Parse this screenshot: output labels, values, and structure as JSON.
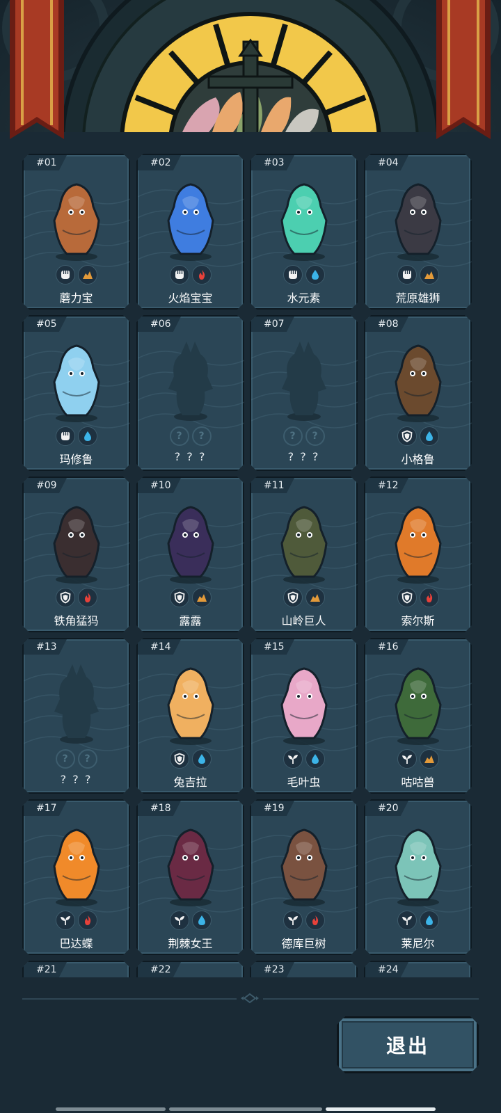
{
  "header": {
    "window_colors": [
      "#f2c84a",
      "#e9a86d",
      "#8aa36a",
      "#d9a4b0",
      "#c9c7c0"
    ],
    "banner_color": "#9b3320"
  },
  "cards": [
    {
      "number": "#01",
      "name": "蘑力宝",
      "types": [
        "fist-icon",
        "earth-icon"
      ],
      "locked": false,
      "color": "#b86a3a"
    },
    {
      "number": "#02",
      "name": "火焰宝宝",
      "types": [
        "fist-icon",
        "fire-icon"
      ],
      "locked": false,
      "color": "#3f7de0"
    },
    {
      "number": "#03",
      "name": "水元素",
      "types": [
        "fist-icon",
        "water-icon"
      ],
      "locked": false,
      "color": "#4ccfb0"
    },
    {
      "number": "#04",
      "name": "荒原雄狮",
      "types": [
        "fist-icon",
        "earth-icon"
      ],
      "locked": false,
      "color": "#3b3a44"
    },
    {
      "number": "#05",
      "name": "玛修鲁",
      "types": [
        "fist-icon",
        "water-icon"
      ],
      "locked": false,
      "color": "#8fd0ef"
    },
    {
      "number": "#06",
      "name": "? ? ?",
      "types": [
        "?",
        "?"
      ],
      "locked": true,
      "color": "#233b48"
    },
    {
      "number": "#07",
      "name": "? ? ?",
      "types": [
        "?",
        "?"
      ],
      "locked": true,
      "color": "#233b48"
    },
    {
      "number": "#08",
      "name": "小格鲁",
      "types": [
        "shield-icon",
        "water-icon"
      ],
      "locked": false,
      "color": "#6b4a2e"
    },
    {
      "number": "#09",
      "name": "铁角猛犸",
      "types": [
        "shield-icon",
        "fire-icon"
      ],
      "locked": false,
      "color": "#3a2e30"
    },
    {
      "number": "#10",
      "name": "露露",
      "types": [
        "shield-icon",
        "earth-icon"
      ],
      "locked": false,
      "color": "#3a2e5a"
    },
    {
      "number": "#11",
      "name": "山岭巨人",
      "types": [
        "shield-icon",
        "earth-icon"
      ],
      "locked": false,
      "color": "#4f5a3a"
    },
    {
      "number": "#12",
      "name": "索尔斯",
      "types": [
        "shield-icon",
        "fire-icon"
      ],
      "locked": false,
      "color": "#e07a2a"
    },
    {
      "number": "#13",
      "name": "? ? ?",
      "types": [
        "?",
        "?"
      ],
      "locked": true,
      "color": "#233b48"
    },
    {
      "number": "#14",
      "name": "兔吉拉",
      "types": [
        "shield-icon",
        "water-icon"
      ],
      "locked": false,
      "color": "#f0b060"
    },
    {
      "number": "#15",
      "name": "毛叶虫",
      "types": [
        "sprout-icon",
        "water-icon"
      ],
      "locked": false,
      "color": "#e8a8c8"
    },
    {
      "number": "#16",
      "name": "咕咕兽",
      "types": [
        "sprout-icon",
        "earth-icon"
      ],
      "locked": false,
      "color": "#3e6a3a"
    },
    {
      "number": "#17",
      "name": "巴达蝶",
      "types": [
        "sprout-icon",
        "fire-icon"
      ],
      "locked": false,
      "color": "#f08a2a"
    },
    {
      "number": "#18",
      "name": "荆棘女王",
      "types": [
        "sprout-icon",
        "water-icon"
      ],
      "locked": false,
      "color": "#6a2a44"
    },
    {
      "number": "#19",
      "name": "德库巨树",
      "types": [
        "sprout-icon",
        "fire-icon"
      ],
      "locked": false,
      "color": "#7a5240"
    },
    {
      "number": "#20",
      "name": "莱尼尔",
      "types": [
        "sprout-icon",
        "water-icon"
      ],
      "locked": false,
      "color": "#7cc4b8"
    },
    {
      "number": "#21",
      "name": "",
      "types": [],
      "locked": false,
      "color": "#2b4656"
    },
    {
      "number": "#22",
      "name": "",
      "types": [],
      "locked": false,
      "color": "#2b4656"
    },
    {
      "number": "#23",
      "name": "",
      "types": [],
      "locked": false,
      "color": "#2b4656"
    },
    {
      "number": "#24",
      "name": "",
      "types": [],
      "locked": false,
      "color": "#2b4656"
    }
  ],
  "footer": {
    "exit_label": "退出"
  }
}
